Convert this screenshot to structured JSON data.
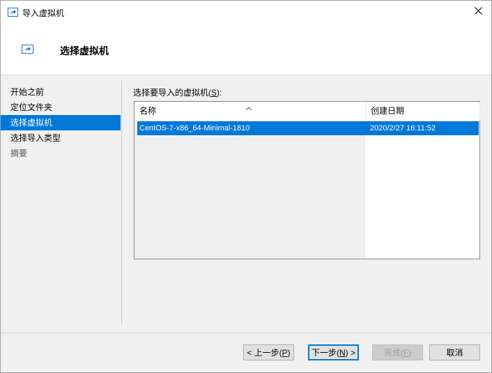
{
  "window": {
    "title": "导入虚拟机",
    "icon": "import-arrow-icon",
    "close_icon": "close-icon"
  },
  "header": {
    "title": "选择虚拟机",
    "icon": "import-arrow-icon"
  },
  "nav": {
    "items": [
      {
        "label": "开始之前",
        "state": "normal"
      },
      {
        "label": "定位文件夹",
        "state": "normal"
      },
      {
        "label": "选择虚拟机",
        "state": "selected"
      },
      {
        "label": "选择导入类型",
        "state": "normal"
      },
      {
        "label": "摘要",
        "state": "disabled"
      }
    ]
  },
  "list": {
    "label_prefix": "选择要导入的虚拟机(",
    "label_key": "S",
    "label_suffix": "):",
    "columns": [
      "名称",
      "创建日期"
    ],
    "rows": [
      {
        "name": "CentOS-7-x86_64-Minimal-1810",
        "created": "2020/2/27 16:11:52",
        "selected": true
      }
    ]
  },
  "buttons": {
    "prev": {
      "prefix": "< 上一步(",
      "key": "P",
      "suffix": ")"
    },
    "next": {
      "prefix": "下一步(",
      "key": "N",
      "suffix": ") >"
    },
    "finish": {
      "prefix": "完成(",
      "key": "F",
      "suffix": ")"
    },
    "cancel": {
      "label": "取消"
    }
  },
  "colors": {
    "accent": "#0078d7",
    "background": "#f0f0f0"
  }
}
